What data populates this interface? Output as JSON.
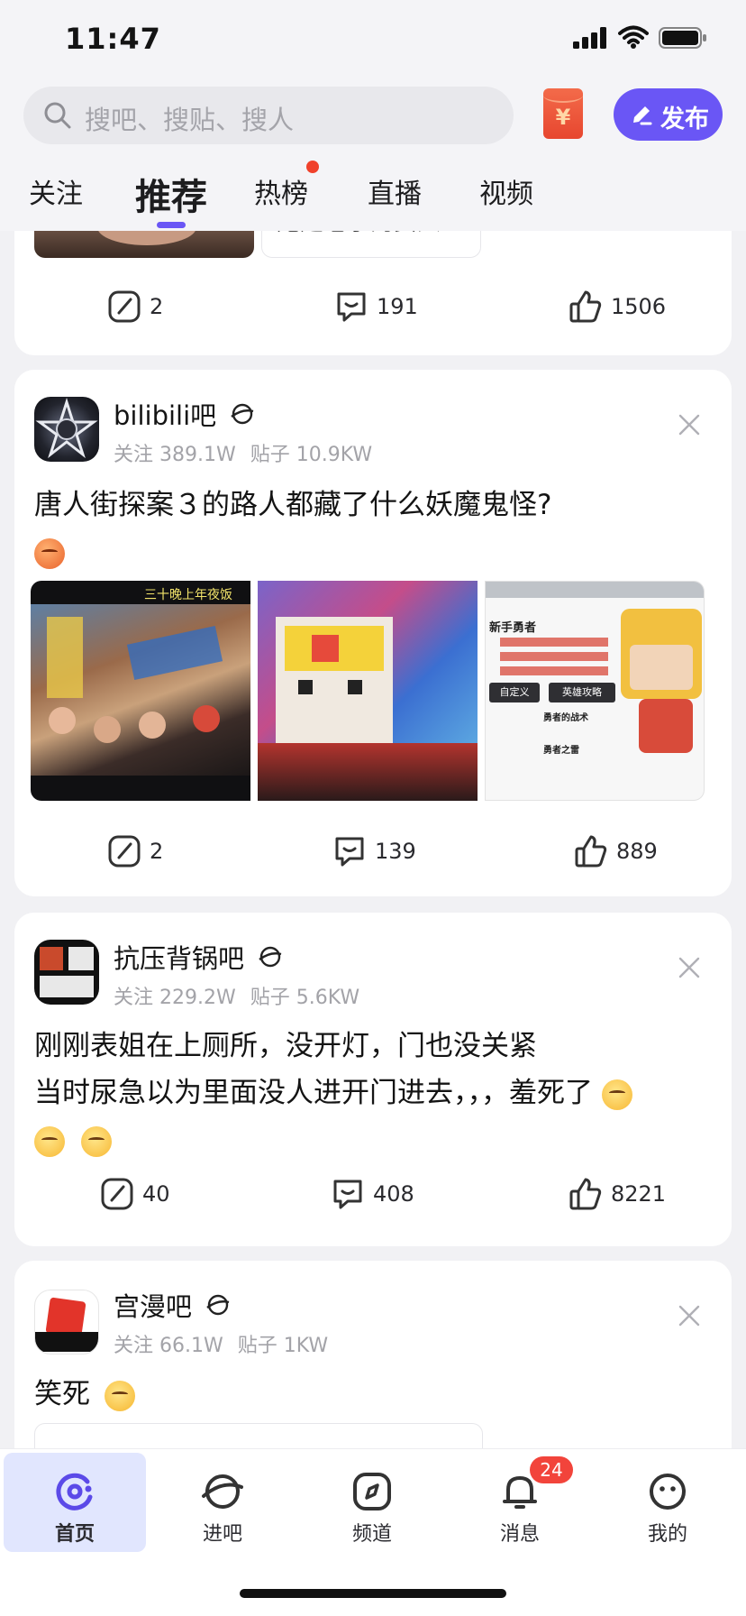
{
  "status_bar": {
    "time": "11:47"
  },
  "search": {
    "placeholder": "搜吧、搜贴、搜人"
  },
  "red_packet": {
    "symbol": "¥"
  },
  "publish_button": {
    "label": "发布"
  },
  "tabs": [
    {
      "label": "关注"
    },
    {
      "label": "推荐",
      "active": true
    },
    {
      "label": "热榜",
      "has_dot": true
    },
    {
      "label": "直播"
    },
    {
      "label": "视频"
    }
  ],
  "feed": {
    "partial_card": {
      "caption_fragment": "她是老子的女人",
      "share_count": "2",
      "comment_count": "191",
      "like_count": "1506"
    },
    "posts": [
      {
        "forum_name": "bilibili吧",
        "followers": "关注 389.1W",
        "post_count": "贴子 10.9KW",
        "text": "唐人街探案３的路人都藏了什么妖魔鬼怪?",
        "image_1_caption": "三十晚上年夜饭",
        "image_3_title": "新手勇者",
        "image_3_btn_a": "自定义",
        "image_3_btn_b": "英雄攻略",
        "image_3_row_a": "勇者的战术",
        "image_3_row_b": "勇者之雷",
        "share_count": "2",
        "comment_count": "139",
        "like_count": "889"
      },
      {
        "forum_name": "抗压背锅吧",
        "followers": "关注 229.2W",
        "post_count": "贴子 5.6KW",
        "text_line_1": "刚刚表姐在上厕所，没开灯，门也没关紧",
        "text_line_2": "当时尿急以为里面没人进开门进去，，，羞死了",
        "share_count": "40",
        "comment_count": "408",
        "like_count": "8221"
      },
      {
        "forum_name": "宫漫吧",
        "followers": "关注 66.1W",
        "post_count": "贴子 1KW",
        "text": "笑死"
      }
    ]
  },
  "bottom_nav": [
    {
      "label": "首页",
      "icon": "home-icon",
      "active": true
    },
    {
      "label": "进吧",
      "icon": "planet-icon"
    },
    {
      "label": "频道",
      "icon": "compass-icon"
    },
    {
      "label": "消息",
      "icon": "bell-icon",
      "badge": "24"
    },
    {
      "label": "我的",
      "icon": "face-icon"
    }
  ],
  "colors": {
    "accent": "#6a56f5",
    "badge_red": "#f2443b",
    "nav_active_bg": "#e1e6fe"
  }
}
